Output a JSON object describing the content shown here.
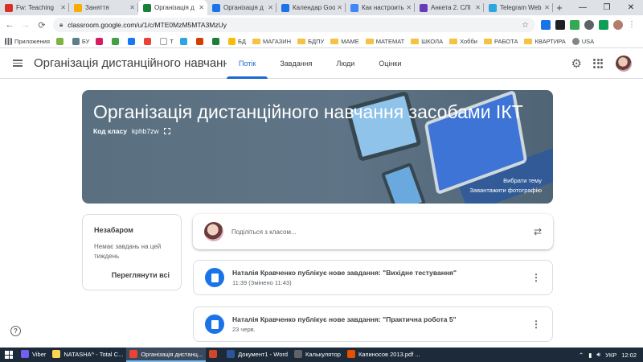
{
  "browser": {
    "tabs": [
      {
        "label": "Fw: Teaching",
        "fav_color": "#d93025",
        "active": false
      },
      {
        "label": "Заняття",
        "fav_color": "#f9ab00",
        "active": false
      },
      {
        "label": "Організація д",
        "fav_color": "#188038",
        "active": true
      },
      {
        "label": "Організація д",
        "fav_color": "#1a73e8",
        "active": false
      },
      {
        "label": "Календар Goo",
        "fav_color": "#1a73e8",
        "active": false
      },
      {
        "label": "Как настроить",
        "fav_color": "#4285f4",
        "active": false
      },
      {
        "label": "Анкета 2. СЛІ",
        "fav_color": "#673ab7",
        "active": false
      },
      {
        "label": "Telegram Web",
        "fav_color": "#2ca5e0",
        "active": false
      }
    ],
    "url": "classroom.google.com/u/1/c/MTE0MzM5MTA3MzUy",
    "bookmarks": [
      {
        "label": "Приложения",
        "kind": "apps"
      },
      {
        "label": "",
        "kind": "icon",
        "color": "#7cb342"
      },
      {
        "label": "БУ",
        "kind": "icon",
        "color": "#607d8b"
      },
      {
        "label": "",
        "kind": "icon",
        "color": "#d81b60"
      },
      {
        "label": "",
        "kind": "icon",
        "color": "#43a047"
      },
      {
        "label": "",
        "kind": "icon",
        "color": "#1877f2"
      },
      {
        "label": "",
        "kind": "icon",
        "color": "#ea4335"
      },
      {
        "label": "Т",
        "kind": "icon",
        "color": "#ffffff"
      },
      {
        "label": "",
        "kind": "icon",
        "color": "#2ca5e0"
      },
      {
        "label": "",
        "kind": "icon",
        "color": "#d83b01"
      },
      {
        "label": "",
        "kind": "icon",
        "color": "#188038"
      },
      {
        "label": "БД",
        "kind": "icon",
        "color": "#fbbc04"
      },
      {
        "label": "МАГАЗИН",
        "kind": "folder"
      },
      {
        "label": "БДПУ",
        "kind": "folder"
      },
      {
        "label": "МАМЕ",
        "kind": "folder"
      },
      {
        "label": "МАТЕМАТ",
        "kind": "folder"
      },
      {
        "label": "ШКОЛА",
        "kind": "folder"
      },
      {
        "label": "Хобби",
        "kind": "folder"
      },
      {
        "label": "РАБОТА",
        "kind": "folder"
      },
      {
        "label": "КВАРТИРА",
        "kind": "folder"
      },
      {
        "label": "USA",
        "kind": "globe"
      }
    ]
  },
  "header": {
    "title": "Організація дистанційного навчання з...",
    "tabs": [
      "Потік",
      "Завдання",
      "Люди",
      "Оцінки"
    ]
  },
  "banner": {
    "title": "Організація дистанційного навчання засобами ІКТ",
    "code_label": "Код класу",
    "code_value": "kphb7zw",
    "select_theme": "Вибрати тему",
    "upload_photo": "Завантажити фотографію"
  },
  "upcoming": {
    "heading": "Незабаром",
    "text": "Немає завдань на цей тиждень",
    "view_all": "Переглянути всі"
  },
  "share": {
    "placeholder": "Поділіться з класом..."
  },
  "posts": [
    {
      "title": "Наталія Кравченко публікує нове завдання: \"Вихідне тестування\"",
      "meta": "11:39 (Змінено 11:43)"
    },
    {
      "title": "Наталія Кравченко публікує нове завдання: \"Практична робота 5\"",
      "meta": "23 черв."
    }
  ],
  "taskbar": {
    "items": [
      {
        "label": "Viber",
        "color": "#7360f2",
        "active": false
      },
      {
        "label": "NATASHA^ - Total C...",
        "color": "#ffd54f",
        "active": false
      },
      {
        "label": "Організація дистанц...",
        "color": "#ea4335",
        "active": true
      },
      {
        "label": "",
        "color": "#d24726",
        "active": false
      },
      {
        "label": "Документ1 - Word",
        "color": "#2b579a",
        "active": false
      },
      {
        "label": "Калькулятор",
        "color": "#5f6368",
        "active": false
      },
      {
        "label": "Капиносов 2013.pdf ...",
        "color": "#e65100",
        "active": false
      }
    ],
    "lang": "УКР",
    "time": "12:02"
  }
}
